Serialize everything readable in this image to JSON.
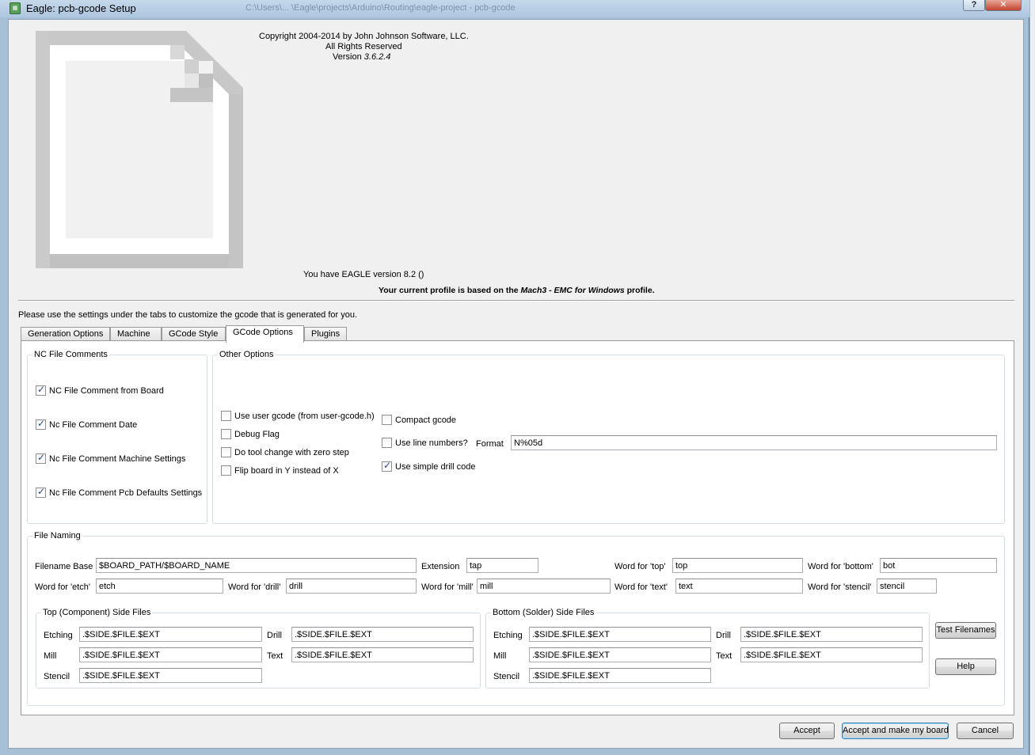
{
  "window": {
    "title": "Eagle: pcb-gcode Setup",
    "icon": "app-icon",
    "help_button": "?",
    "close_button": "✕",
    "background_title": "C:\\Users\\... \\Eagle\\projects\\Arduino\\Routing\\eagle-project - pcb-gcode"
  },
  "header": {
    "copyright": "Copyright 2004-2014 by John Johnson Software, LLC.",
    "rights": "All Rights Reserved",
    "version_label": "Version",
    "version_number": "3.6.2.4",
    "eagle_version": "You have EAGLE version 8.2 ()",
    "profile_prefix": "Your current profile is based on the",
    "profile_name": "Mach3 - EMC for Windows",
    "profile_suffix": "profile.",
    "instructions": "Please use the settings under the tabs to customize the gcode that is generated for you."
  },
  "tabs": [
    {
      "label": "Generation Options",
      "active": false
    },
    {
      "label": "Machine",
      "active": false
    },
    {
      "label": "GCode Style",
      "active": false
    },
    {
      "label": "GCode Options",
      "active": true
    },
    {
      "label": "Plugins",
      "active": false
    }
  ],
  "nc_file_comments": {
    "title": "NC File Comments",
    "items": [
      {
        "label": "NC File Comment from Board",
        "checked": true
      },
      {
        "label": "Nc File Comment Date",
        "checked": true
      },
      {
        "label": "Nc File Comment Machine Settings",
        "checked": true
      },
      {
        "label": "Nc File Comment Pcb Defaults Settings",
        "checked": true
      }
    ]
  },
  "other_options": {
    "title": "Other Options",
    "left_items": [
      {
        "label": "Use user gcode (from user-gcode.h)",
        "checked": false
      },
      {
        "label": "Debug Flag",
        "checked": false
      },
      {
        "label": "Do tool change with zero step",
        "checked": false
      },
      {
        "label": "Flip board in Y instead of X",
        "checked": false
      }
    ],
    "compact_gcode": {
      "label": "Compact gcode",
      "checked": false
    },
    "use_line_numbers": {
      "label": "Use line numbers?",
      "checked": false
    },
    "format_label": "Format",
    "format_value": "N%05d",
    "simple_drill": {
      "label": "Use simple drill code",
      "checked": true
    }
  },
  "file_naming": {
    "title": "File Naming",
    "filename_base_label": "Filename Base",
    "filename_base": "$BOARD_PATH/$BOARD_NAME",
    "extension_label": "Extension",
    "extension": "tap",
    "word_top_label": "Word for 'top'",
    "word_top": "top",
    "word_bottom_label": "Word for 'bottom'",
    "word_bottom": "bot",
    "word_etch_label": "Word for 'etch'",
    "word_etch": "etch",
    "word_drill_label": "Word for 'drill'",
    "word_drill": "drill",
    "word_mill_label": "Word for 'mill'",
    "word_mill": "mill",
    "word_text_label": "Word for 'text'",
    "word_text": "text",
    "word_stencil_label": "Word for 'stencil'",
    "word_stencil": "stencil",
    "top_side": {
      "title": "Top (Component) Side Files",
      "etching_label": "Etching",
      "etching": ".$SIDE.$FILE.$EXT",
      "drill_label": "Drill",
      "drill": ".$SIDE.$FILE.$EXT",
      "mill_label": "Mill",
      "mill": ".$SIDE.$FILE.$EXT",
      "text_label": "Text",
      "text": ".$SIDE.$FILE.$EXT",
      "stencil_label": "Stencil",
      "stencil": ".$SIDE.$FILE.$EXT"
    },
    "bottom_side": {
      "title": "Bottom (Solder) Side Files",
      "etching_label": "Etching",
      "etching": ".$SIDE.$FILE.$EXT",
      "drill_label": "Drill",
      "drill": ".$SIDE.$FILE.$EXT",
      "mill_label": "Mill",
      "mill": ".$SIDE.$FILE.$EXT",
      "text_label": "Text",
      "text": ".$SIDE.$FILE.$EXT",
      "stencil_label": "Stencil",
      "stencil": ".$SIDE.$FILE.$EXT"
    },
    "test_filenames_button": "Test Filenames",
    "help_button": "Help"
  },
  "footer": {
    "accept": "Accept",
    "accept_make_board": "Accept and make my board",
    "cancel": "Cancel"
  }
}
